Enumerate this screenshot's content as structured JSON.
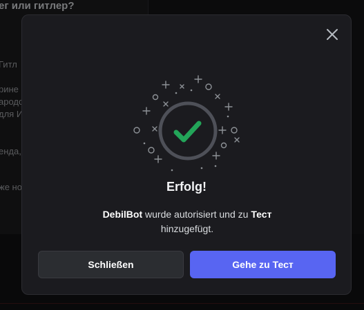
{
  "background": {
    "title_fragment": "ег или гитлер?",
    "lines": [
      "Гитл",
      "рине",
      "ародо",
      "для И",
      "енда,",
      "же но"
    ]
  },
  "modal": {
    "title": "Erfolg!",
    "message": {
      "bot_name": "DebilBot",
      "middle": " wurde autorisiert und zu ",
      "server_name": "Тест",
      "tail": "hinzugefügt."
    },
    "buttons": {
      "close_label": "Schließen",
      "go_prefix": "Gehe zu ",
      "go_server": "Тест"
    },
    "icons": {
      "close": "close-icon",
      "success": "checkmark-icon"
    }
  },
  "colors": {
    "accent": "#5865f2",
    "success": "#23a559",
    "modal_bg": "#1b1b1f",
    "secondary_button": "#2b2d31"
  }
}
